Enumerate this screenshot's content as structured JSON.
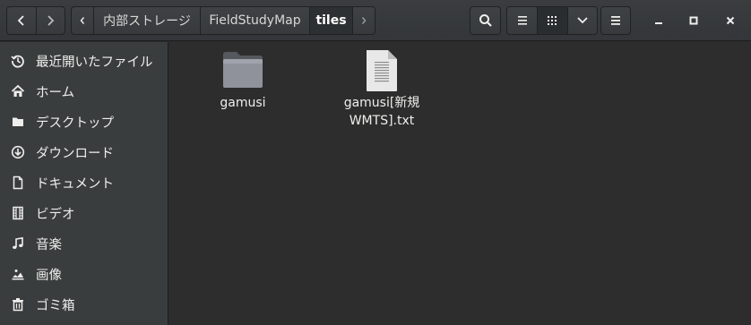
{
  "header": {
    "path": [
      "内部ストレージ",
      "FieldStudyMap",
      "tiles"
    ],
    "current": "tiles"
  },
  "sidebar": {
    "items": [
      {
        "label": "最近開いたファイル",
        "icon": "recent-icon"
      },
      {
        "label": "ホーム",
        "icon": "home-icon"
      },
      {
        "label": "デスクトップ",
        "icon": "folder-icon"
      },
      {
        "label": "ダウンロード",
        "icon": "download-icon"
      },
      {
        "label": "ドキュメント",
        "icon": "document-icon"
      },
      {
        "label": "ビデオ",
        "icon": "film-icon"
      },
      {
        "label": "音楽",
        "icon": "music-icon"
      },
      {
        "label": "画像",
        "icon": "image-icon"
      },
      {
        "label": "ゴミ箱",
        "icon": "trash-icon"
      }
    ]
  },
  "files": [
    {
      "name": "gamusi",
      "type": "folder"
    },
    {
      "name_line1": "gamusi[新規",
      "name_line2": "WMTS].txt",
      "type": "text-file"
    }
  ]
}
